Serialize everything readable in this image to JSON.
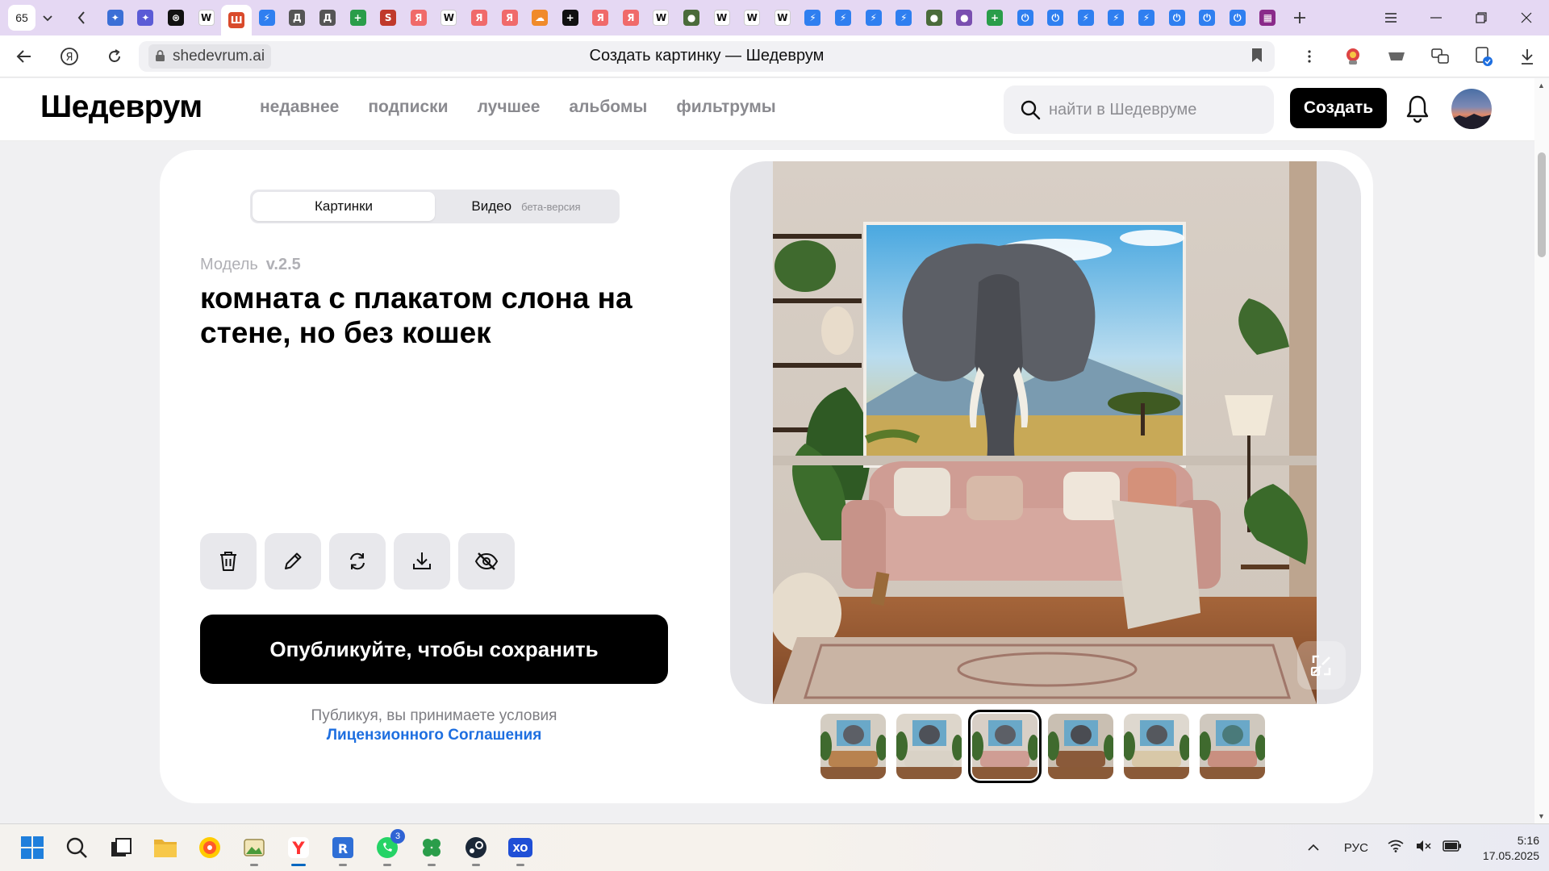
{
  "browser": {
    "tab_count": "65",
    "page_title": "Создать картинку — Шедеврум",
    "url_host": "shedevrum.ai",
    "tab_favicons": [
      {
        "icon": "copilot-icon",
        "color": "#3b6fd6",
        "glyph": "✦"
      },
      {
        "icon": "perplexity-icon",
        "color": "#5b5bd6",
        "glyph": "✦"
      },
      {
        "icon": "chatgpt-icon",
        "color": "#111111",
        "glyph": "⊛"
      },
      {
        "icon": "wikipedia-icon",
        "color": "#ffffff",
        "glyph": "W"
      },
      {
        "icon": "shedevrum-icon",
        "color": "#d94a2b",
        "glyph": "Ш",
        "active": true
      },
      {
        "icon": "lightning-icon",
        "color": "#2f7ff0",
        "glyph": "⚡"
      },
      {
        "icon": "d-icon",
        "color": "#555555",
        "glyph": "Д"
      },
      {
        "icon": "d-icon",
        "color": "#555555",
        "glyph": "Д"
      },
      {
        "icon": "plus-circle-icon",
        "color": "#2a9d4a",
        "glyph": "+"
      },
      {
        "icon": "s-icon",
        "color": "#c0392b",
        "glyph": "S"
      },
      {
        "icon": "yandex-icon",
        "color": "#f06a6a",
        "glyph": "Я"
      },
      {
        "icon": "wikipedia-icon",
        "color": "#ffffff",
        "glyph": "W"
      },
      {
        "icon": "yandex-icon",
        "color": "#f06a6a",
        "glyph": "Я"
      },
      {
        "icon": "yandex-icon",
        "color": "#f06a6a",
        "glyph": "Я"
      },
      {
        "icon": "cloud-icon",
        "color": "#f08a2a",
        "glyph": "☁"
      },
      {
        "icon": "plus-square-icon",
        "color": "#111111",
        "glyph": "+"
      },
      {
        "icon": "yandex-icon",
        "color": "#f06a6a",
        "glyph": "Я"
      },
      {
        "icon": "yandex-icon",
        "color": "#f06a6a",
        "glyph": "Я"
      },
      {
        "icon": "wikipedia-icon",
        "color": "#ffffff",
        "glyph": "W"
      },
      {
        "icon": "turtle-icon",
        "color": "#4a6b3a",
        "glyph": "●"
      },
      {
        "icon": "wikipedia-icon",
        "color": "#ffffff",
        "glyph": "W"
      },
      {
        "icon": "wikipedia-icon",
        "color": "#ffffff",
        "glyph": "W"
      },
      {
        "icon": "wikipedia-icon",
        "color": "#ffffff",
        "glyph": "W"
      },
      {
        "icon": "lightning-icon",
        "color": "#2f7ff0",
        "glyph": "⚡"
      },
      {
        "icon": "lightning-icon",
        "color": "#2f7ff0",
        "glyph": "⚡"
      },
      {
        "icon": "lightning-icon",
        "color": "#2f7ff0",
        "glyph": "⚡"
      },
      {
        "icon": "lightning-icon",
        "color": "#2f7ff0",
        "glyph": "⚡"
      },
      {
        "icon": "turtle-icon",
        "color": "#4a6b3a",
        "glyph": "●"
      },
      {
        "icon": "user-icon",
        "color": "#7a4fb0",
        "glyph": "●"
      },
      {
        "icon": "plus-circle-icon",
        "color": "#2a9d4a",
        "glyph": "+"
      },
      {
        "icon": "power-icon",
        "color": "#2f7ff0",
        "glyph": "⏻"
      },
      {
        "icon": "power-icon",
        "color": "#2f7ff0",
        "glyph": "⏻"
      },
      {
        "icon": "lightning-icon",
        "color": "#2f7ff0",
        "glyph": "⚡"
      },
      {
        "icon": "lightning-icon",
        "color": "#2f7ff0",
        "glyph": "⚡"
      },
      {
        "icon": "lightning-icon",
        "color": "#2f7ff0",
        "glyph": "⚡"
      },
      {
        "icon": "power-icon",
        "color": "#2f7ff0",
        "glyph": "⏻"
      },
      {
        "icon": "power-icon",
        "color": "#2f7ff0",
        "glyph": "⏻"
      },
      {
        "icon": "power-icon",
        "color": "#2f7ff0",
        "glyph": "⏻"
      },
      {
        "icon": "grid-icon",
        "color": "#8a2a8a",
        "glyph": "▦"
      }
    ]
  },
  "site": {
    "logo": "Шедеврум",
    "nav": [
      "недавнее",
      "подписки",
      "лучшее",
      "альбомы",
      "фильтрумы"
    ],
    "search_placeholder": "найти в Шедевруме",
    "create_label": "Создать"
  },
  "editor": {
    "tabs": [
      {
        "label": "Картинки",
        "active": true
      },
      {
        "label": "Видео",
        "badge": "бета-версия",
        "active": false
      }
    ],
    "model_label": "Модель",
    "model_version": "v.2.5",
    "prompt": "комната с плакатом слона на стене, но без кошек",
    "actions": [
      "trash-icon",
      "pencil-icon",
      "refresh-icon",
      "download-icon",
      "hide-icon"
    ],
    "publish_label": "Опубликуйте, чтобы сохранить",
    "terms_text": "Публикуя, вы принимаете условия",
    "terms_link": "Лицензионного Соглашения",
    "thumbnail_count": 6,
    "selected_thumbnail": 3
  },
  "taskbar": {
    "apps": [
      "windows-start-icon",
      "search-icon",
      "task-view-icon",
      "file-explorer-icon",
      "yandex-music-icon",
      "image-viewer-icon",
      "yandex-browser-icon",
      "remote-app-icon",
      "whatsapp-icon",
      "clover-icon",
      "steam-icon",
      "xo-icon"
    ],
    "whatsapp_badge": "3",
    "language": "РУС",
    "time": "5:16",
    "date": "17.05.2025"
  }
}
